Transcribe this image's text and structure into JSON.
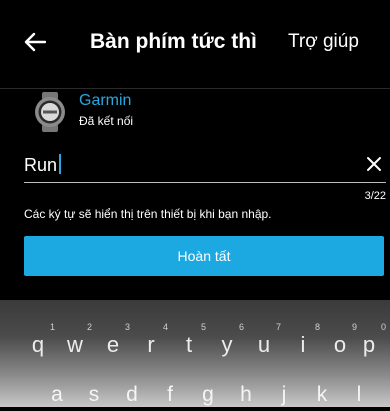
{
  "header": {
    "title": "Bàn phím tức thì",
    "help_label": "Trợ giúp"
  },
  "device": {
    "name": "Garmin",
    "status": "Đã kết nối"
  },
  "message_input": {
    "value": "Run"
  },
  "counter": "3/22",
  "hint": "Các ký tự sẽ hiển thị trên thiết bị khi bạn nhập.",
  "done_button": "Hoàn tất",
  "keyboard": {
    "row1": [
      {
        "num": "1",
        "ch": "q"
      },
      {
        "num": "2",
        "ch": "w"
      },
      {
        "num": "3",
        "ch": "e"
      },
      {
        "num": "4",
        "ch": "r"
      },
      {
        "num": "5",
        "ch": "t"
      },
      {
        "num": "6",
        "ch": "y"
      },
      {
        "num": "7",
        "ch": "u"
      },
      {
        "num": "8",
        "ch": "i"
      },
      {
        "num": "9",
        "ch": "o"
      },
      {
        "num": "0",
        "ch": "p"
      }
    ],
    "row2": [
      "a",
      "s",
      "d",
      "f",
      "g",
      "h",
      "j",
      "k",
      "l"
    ]
  },
  "colors": {
    "accent": "#1ca9e2",
    "background": "#000000"
  },
  "icons": {
    "back": "arrow-left-icon",
    "clear": "close-icon",
    "device": "watch-icon"
  }
}
